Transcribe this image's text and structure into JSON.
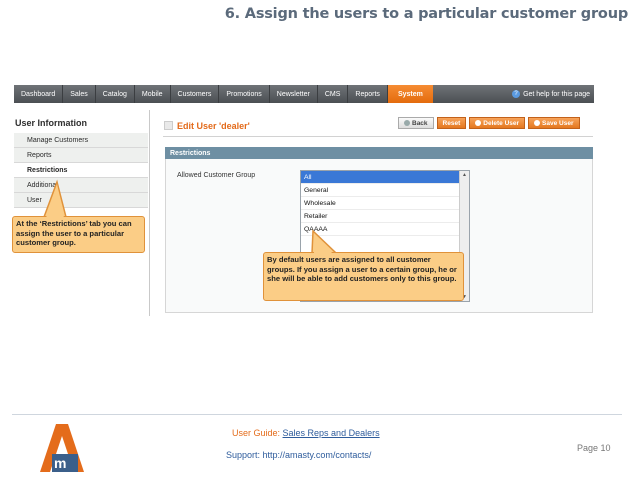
{
  "slide": {
    "title": "6. Assign the users to a particular customer group"
  },
  "nav": {
    "items": [
      "Dashboard",
      "Sales",
      "Catalog",
      "Mobile",
      "Customers",
      "Promotions",
      "Newsletter",
      "CMS",
      "Reports",
      "System"
    ],
    "active": "System",
    "help": "Get help for this page"
  },
  "sidebar": {
    "title": "User Information",
    "items": [
      "Manage Customers",
      "Reports",
      "Restrictions",
      "Additional",
      "User"
    ]
  },
  "page": {
    "title": "Edit User 'dealer'",
    "buttons": {
      "back": "Back",
      "reset": "Reset",
      "delete": "Delete User",
      "save": "Save User"
    }
  },
  "restrictions": {
    "section": "Restrictions",
    "label": "Allowed Customer Group",
    "options": [
      "All",
      "General",
      "Wholesale",
      "Retailer",
      "QAAAA"
    ],
    "selected": "All"
  },
  "callouts": {
    "left": "At the ‘Restrictions’ tab you can assign the user to a particular customer group.",
    "right": "By default users are assigned to all customer groups. If you assign a user to a certain group, he or she will be able to add customers only to this group."
  },
  "footer": {
    "guide_prefix": "User Guide: ",
    "guide_link": "Sales Reps and Dealers",
    "support": "Support: http://amasty.com/contacts/",
    "page": "Page 10"
  },
  "colors": {
    "accent": "#e46c1b",
    "nav": "#5a5e62",
    "section": "#6e8fa3",
    "callout": "#fbcd86"
  }
}
